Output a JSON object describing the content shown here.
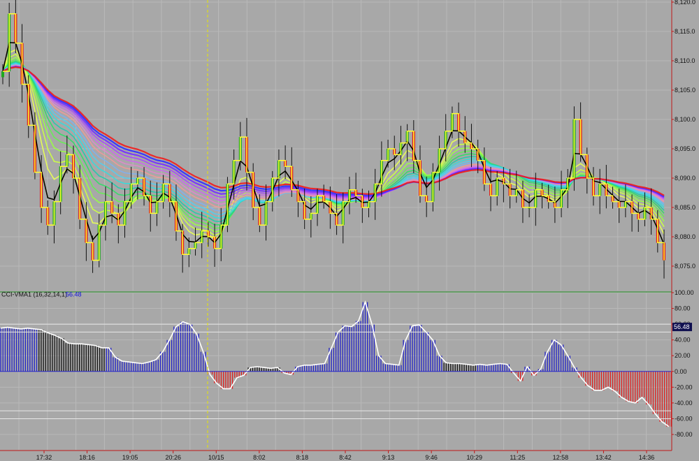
{
  "chart_data": [
    {
      "type": "candlestick",
      "panel": "price",
      "ylim": [
        8072,
        8120
      ],
      "y_ticks": [
        "8,120.0",
        "8,115.0",
        "8,110.0",
        "8,105.0",
        "8,100.0",
        "8,095.0",
        "8,090.0",
        "8,085.0",
        "8,080.0",
        "8,075.0"
      ],
      "y_tick_values": [
        8120,
        8115,
        8110,
        8105,
        8100,
        8095,
        8090,
        8085,
        8080,
        8075
      ],
      "grid": true,
      "closes": [
        8108.2,
        8118,
        8113,
        8106,
        8099,
        8091,
        8085,
        8082,
        8086,
        8092,
        8094,
        8090,
        8083,
        8079,
        8076,
        8082,
        8086,
        8084,
        8082,
        8086,
        8089,
        8090,
        8087,
        8084,
        8086,
        8089,
        8086,
        8081,
        8077,
        8078,
        8079,
        8081,
        8080,
        8078,
        8082,
        8089,
        8093,
        8097,
        8091,
        8085,
        8082,
        8086,
        8090,
        8093,
        8092,
        8088,
        8086,
        8083,
        8084,
        8087,
        8086,
        8084,
        8082,
        8086,
        8088,
        8087,
        8085,
        8086,
        8089,
        8093,
        8095,
        8094,
        8096,
        8098,
        8093,
        8087,
        8086,
        8091,
        8095,
        8098,
        8101,
        8098,
        8096,
        8095,
        8093,
        8089,
        8087,
        8090,
        8089,
        8087,
        8088,
        8085,
        8085,
        8088,
        8087,
        8086,
        8085,
        8088,
        8090,
        8100,
        8094,
        8090,
        8087,
        8089,
        8087,
        8086,
        8085,
        8086,
        8084,
        8083,
        8085,
        8083,
        8079,
        8076
      ],
      "x_ticks": [
        "17:32",
        "18:16",
        "19:05",
        "20:26",
        "10/15",
        "8:02",
        "8:18",
        "8:42",
        "9:13",
        "9:46",
        "10:29",
        "11:25",
        "12:58",
        "13:42",
        "14:36"
      ]
    },
    {
      "type": "bar",
      "panel": "indicator",
      "name": "CCI-VMA1 (16,32,14,1)",
      "last_value": "56.48",
      "ylim": [
        -90,
        103
      ],
      "y_ticks": [
        "100.00",
        "80.00",
        "60.00",
        "40.00",
        "20.00",
        "0.00",
        "-20.00",
        "-40.00",
        "-60.00",
        "-80.00"
      ],
      "y_tick_values": [
        100,
        80,
        60,
        40,
        20,
        0,
        -20,
        -40,
        -60,
        -80
      ],
      "reference_levels": [
        60,
        50,
        -50,
        -60
      ],
      "values": [
        55,
        56,
        55,
        54,
        55,
        54,
        53,
        49,
        46,
        42,
        36,
        35,
        35,
        34,
        33,
        30,
        30,
        18,
        13,
        12,
        11,
        10,
        12,
        15,
        25,
        40,
        57,
        63,
        60,
        48,
        25,
        -4,
        -15,
        -22,
        -22,
        -8,
        -5,
        5,
        6,
        5,
        4,
        5,
        -2,
        -4,
        6,
        8,
        8,
        9,
        10,
        30,
        50,
        58,
        57,
        64,
        88,
        60,
        20,
        10,
        9,
        8,
        40,
        58,
        59,
        50,
        40,
        20,
        11,
        10,
        10,
        9,
        8,
        9,
        8,
        9,
        10,
        9,
        -2,
        -12,
        6,
        -5,
        3,
        25,
        40,
        34,
        20,
        5,
        -8,
        -18,
        -24,
        -24,
        -20,
        -25,
        -33,
        -38,
        -40,
        -33,
        -42,
        -54,
        -64,
        -70
      ],
      "bar_colors": {
        "positive": "#2323c8",
        "neutral": "#141414",
        "negative": "#e02020",
        "outline": "#ffffff"
      }
    }
  ],
  "colors": {
    "background": "#a8a8a8",
    "grid": "#b9b9b9",
    "candle_up": "#1fa81f",
    "candle_down": "#e01818",
    "wick": "#111111",
    "axis_line": "#c01818",
    "session_line": "#e6e600",
    "last_value_badge": "#101050"
  }
}
